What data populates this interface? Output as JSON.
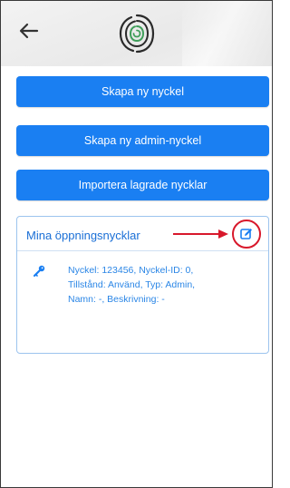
{
  "header": {
    "back_icon": "arrow-left-icon",
    "logo_icon": "fingerprint-logo-icon"
  },
  "actions": {
    "create_key": "Skapa ny nyckel",
    "create_admin_key": "Skapa ny admin-nyckel",
    "import_keys": "Importera lagrade nycklar"
  },
  "keys_card": {
    "title": "Mina öppningsnycklar",
    "edit_icon": "edit-icon",
    "items": [
      {
        "icon": "key-icon",
        "line1": "Nyckel: 123456, Nyckel-ID: 0,",
        "line2": "Tillstånd: Använd, Typ: Admin,",
        "line3": "Namn: -, Beskrivning: -"
      }
    ]
  },
  "colors": {
    "primary": "#1a7ff2",
    "accent_red": "#d8182b",
    "link_blue": "#1a6fd6"
  }
}
